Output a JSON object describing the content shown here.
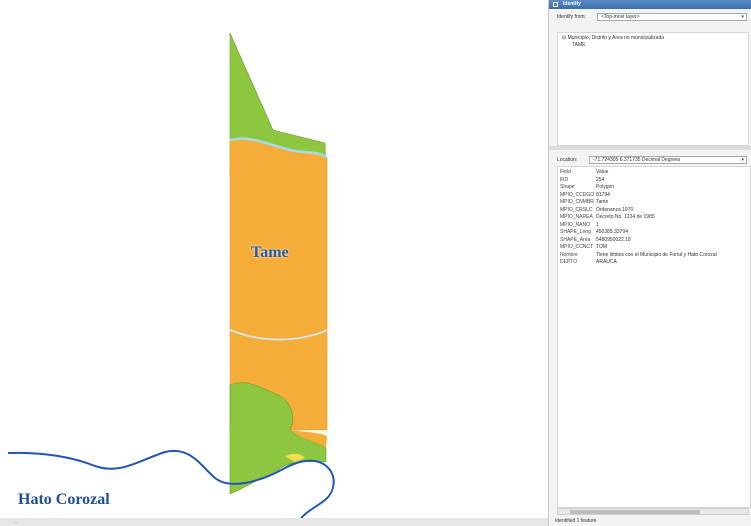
{
  "map": {
    "labels": {
      "tame": "Tame",
      "hato_corozal": "Hato Corozal"
    },
    "colors": {
      "orange": "#f5ad3a",
      "green": "#8dc63f",
      "river": "#1f56b8",
      "water": "#a8d8e8"
    },
    "status_text": "..."
  },
  "identify": {
    "title": "Identify",
    "identify_from_label": "Identify from:",
    "identify_from_value": "<Top-most layer>",
    "tree_root": "Municipio, Distrito y Area no municipalizada",
    "tree_child": "TAME",
    "location_label": "Location:",
    "location_value": "-71.724305 6.371735 Decimal Degrees",
    "attributes": [
      {
        "key": "Field",
        "value": "Value"
      },
      {
        "key": "FID",
        "value": "254"
      },
      {
        "key": "Shape",
        "value": "Polygon"
      },
      {
        "key": "MPIO_CCDGO",
        "value": "81794"
      },
      {
        "key": "MPIO_CNMBR",
        "value": "Tame"
      },
      {
        "key": "MPIO_CRSLC",
        "value": "Ordenanza 1970"
      },
      {
        "key": "MPIO_NAREA",
        "value": "Decreto No. 1234 de 1985"
      },
      {
        "key": "MPIO_NANO",
        "value": "1"
      },
      {
        "key": "SHAPE_Leng",
        "value": "450385.33794"
      },
      {
        "key": "SHAPE_Area",
        "value": "5480950022.18"
      },
      {
        "key": "MPIO_CCNCT",
        "value": "TOM"
      },
      {
        "key": "Nombre",
        "value": "Tiene limites con el Municipio de Fortul y Hato Corozal"
      },
      {
        "key": "DEPTO",
        "value": "ARAUCA"
      }
    ],
    "footer_text": "Identified 1 feature"
  }
}
